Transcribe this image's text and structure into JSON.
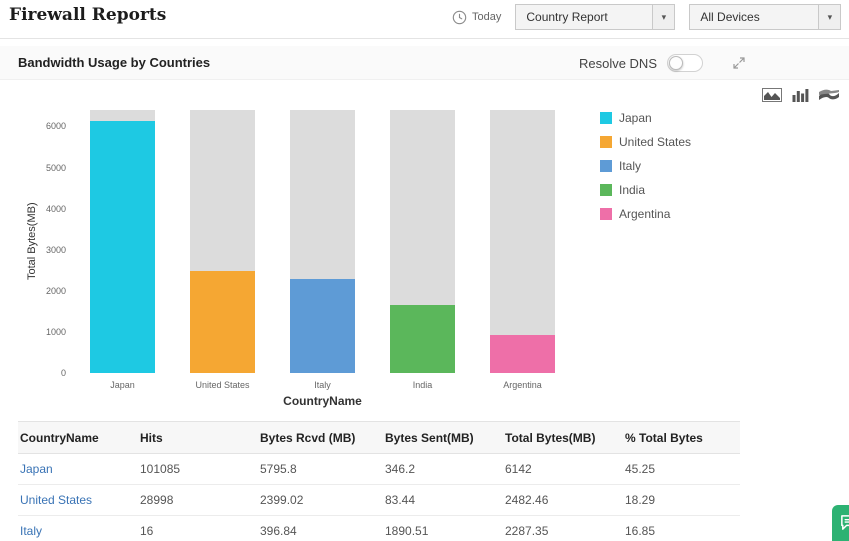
{
  "header": {
    "title": "Firewall Reports",
    "time_label": "Today",
    "report_select": "Country Report",
    "device_select": "All Devices"
  },
  "panel": {
    "title": "Bandwidth Usage by Countries",
    "resolve_dns_label": "Resolve DNS"
  },
  "icons": {
    "time": "clock-icon",
    "report_caret": "▾",
    "expand": "expand-diagonal-icon",
    "chart_type_switcher": [
      "area-chart-icon",
      "bar-chart-icon",
      "stream-chart-icon"
    ],
    "chat": "chat-bubble-icon"
  },
  "colors": {
    "link": "#3973b5",
    "chat_widget": "#2db273",
    "bar_backdrop": "#dcdcdc"
  },
  "chart_data": {
    "type": "bar",
    "title": "Bandwidth Usage by Countries",
    "categories": [
      "Japan",
      "United States",
      "Italy",
      "India",
      "Argentina"
    ],
    "values": [
      6142,
      2482.46,
      2287.35,
      1664,
      930
    ],
    "colors": [
      "#1ec9e3",
      "#f5a733",
      "#5e9bd6",
      "#5bb75b",
      "#ee6fa8"
    ],
    "xlabel": "CountryName",
    "ylabel": "Total Bytes(MB)",
    "ylim": [
      0,
      6400
    ],
    "yticks": [
      0,
      1000,
      2000,
      3000,
      4000,
      5000,
      6000
    ],
    "legend": [
      "Japan",
      "United States",
      "Italy",
      "India",
      "Argentina"
    ],
    "legend_position": "right",
    "grid": false
  },
  "table": {
    "columns": [
      "CountryName",
      "Hits",
      "Bytes Rcvd (MB)",
      "Bytes Sent(MB)",
      "Total Bytes(MB)",
      "% Total Bytes"
    ],
    "rows": [
      [
        "Japan",
        "101085",
        "5795.8",
        "346.2",
        "6142",
        "45.25"
      ],
      [
        "United States",
        "28998",
        "2399.02",
        "83.44",
        "2482.46",
        "18.29"
      ],
      [
        "Italy",
        "16",
        "396.84",
        "1890.51",
        "2287.35",
        "16.85"
      ]
    ]
  }
}
